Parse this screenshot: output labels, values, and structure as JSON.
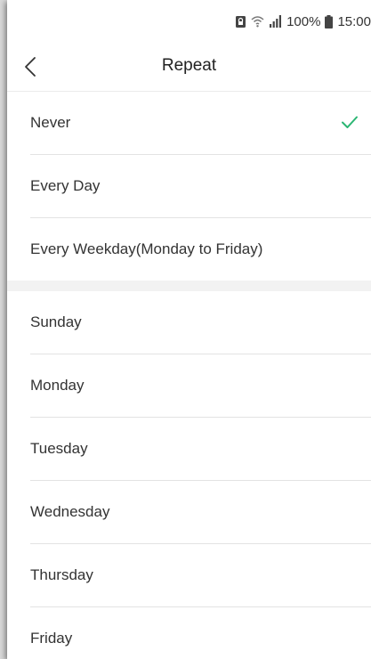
{
  "status": {
    "battery_percent": "100%",
    "time": "15:00"
  },
  "header": {
    "title": "Repeat"
  },
  "repeat_options": [
    {
      "label": "Never",
      "selected": true
    },
    {
      "label": "Every Day",
      "selected": false
    },
    {
      "label": "Every Weekday(Monday to Friday)",
      "selected": false
    }
  ],
  "weekdays": [
    {
      "label": "Sunday"
    },
    {
      "label": "Monday"
    },
    {
      "label": "Tuesday"
    },
    {
      "label": "Wednesday"
    },
    {
      "label": "Thursday"
    },
    {
      "label": "Friday"
    }
  ],
  "colors": {
    "accent_check": "#2bb673"
  },
  "icons": {
    "back": "chevron-left-icon",
    "check": "checkmark-icon",
    "status": [
      "sim-icon",
      "wifi-icon",
      "signal-icon",
      "battery-icon"
    ]
  }
}
